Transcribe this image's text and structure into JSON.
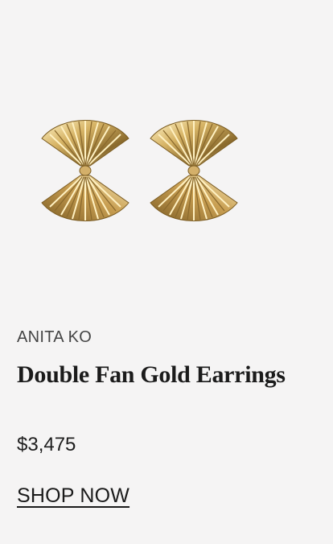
{
  "product": {
    "brand": "ANITA KO",
    "title": "Double Fan Gold Earrings",
    "price": "$3,475",
    "cta_label": "SHOP NOW",
    "image_icon": "gold-fan-earrings-image"
  },
  "colors": {
    "background": "#f5f4f4",
    "text": "#1b1b1b",
    "gold_light": "#f6e3a4",
    "gold_mid": "#d7b466",
    "gold_dark": "#8a6a2c"
  }
}
